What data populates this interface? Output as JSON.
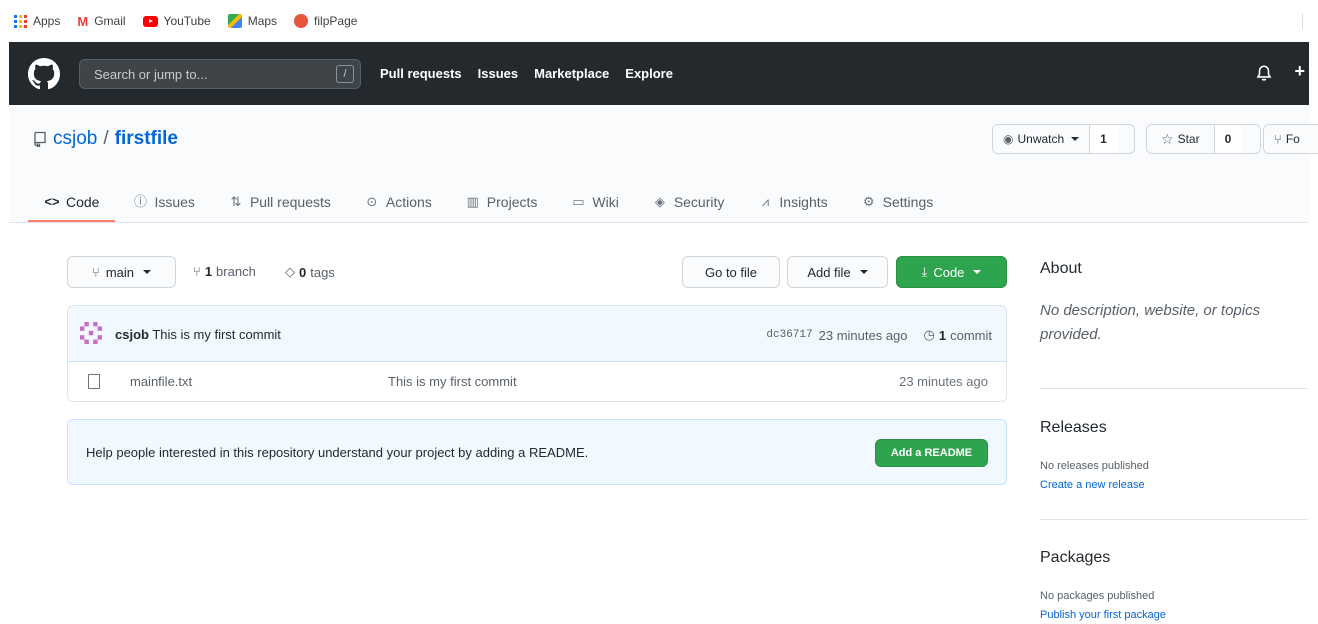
{
  "bookmarks": [
    {
      "label": "Apps",
      "icon": "apps-grid-icon"
    },
    {
      "label": "Gmail",
      "icon": "gmail-icon"
    },
    {
      "label": "YouTube",
      "icon": "youtube-icon"
    },
    {
      "label": "Maps",
      "icon": "maps-icon"
    },
    {
      "label": "filpPage",
      "icon": "flippage-icon"
    }
  ],
  "header": {
    "search_placeholder": "Search or jump to...",
    "search_key": "/",
    "nav": [
      "Pull requests",
      "Issues",
      "Marketplace",
      "Explore"
    ],
    "plus": "+"
  },
  "repo": {
    "owner": "csjob",
    "separator": "/",
    "name": "firstfile",
    "watch_label": "Unwatch",
    "watch_count": "1",
    "star_label": "Star",
    "star_count": "0",
    "fork_label": "Fo"
  },
  "tabs": [
    {
      "label": "Code",
      "icon": "code-icon",
      "active": true
    },
    {
      "label": "Issues",
      "icon": "issue-icon"
    },
    {
      "label": "Pull requests",
      "icon": "pull-request-icon"
    },
    {
      "label": "Actions",
      "icon": "play-icon"
    },
    {
      "label": "Projects",
      "icon": "project-icon"
    },
    {
      "label": "Wiki",
      "icon": "book-icon"
    },
    {
      "label": "Security",
      "icon": "shield-icon"
    },
    {
      "label": "Insights",
      "icon": "graph-icon"
    },
    {
      "label": "Settings",
      "icon": "gear-icon"
    }
  ],
  "toolbar": {
    "branch": "main",
    "branch_count": "1",
    "branch_word": "branch",
    "tag_count": "0",
    "tag_word": "tags",
    "go_to_file": "Go to file",
    "add_file": "Add file",
    "code": "Code"
  },
  "commit": {
    "user": "csjob",
    "message": "This is my first commit",
    "sha": "dc36717",
    "age": "23 minutes ago",
    "count": "1",
    "count_word": "commit"
  },
  "files": [
    {
      "name": "mainfile.txt",
      "message": "This is my first commit",
      "age": "23 minutes ago"
    }
  ],
  "readme": {
    "text": "Help people interested in this repository understand your project by adding a README.",
    "button": "Add a README"
  },
  "sidebar": {
    "about_heading": "About",
    "about_desc": "No description, website, or topics provided.",
    "releases_heading": "Releases",
    "releases_text": "No releases published",
    "releases_link": "Create a new release",
    "packages_heading": "Packages",
    "packages_text": "No packages published",
    "packages_link": "Publish your first package"
  },
  "colors": {
    "header_bg": "#24292e",
    "link": "#0366d6",
    "green": "#2ea44f",
    "tab_underline": "#f9826c",
    "info_bg": "#f1f8ff"
  }
}
